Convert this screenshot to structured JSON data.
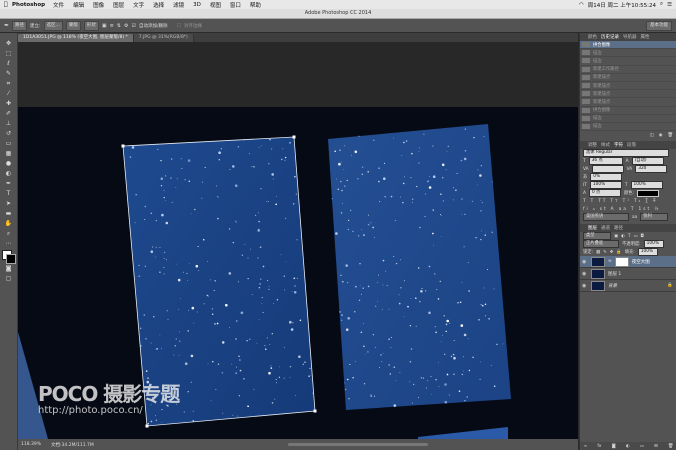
{
  "menubar": {
    "app": "Photoshop",
    "items": [
      "文件",
      "编辑",
      "图像",
      "图层",
      "文字",
      "选择",
      "滤镜",
      "3D",
      "视图",
      "窗口",
      "帮助"
    ],
    "clock": "周14日 周二 上午10:55:24"
  },
  "window_title": "Adobe Photoshop CC 2014",
  "options": {
    "mode": "路径",
    "make_label": "建立:",
    "selection_btn": "选区...",
    "mask_btn": "蒙版",
    "shape_btn": "形状",
    "auto_add_label": "自动添加/删除",
    "align_label": "对齐边缘",
    "workspace": "基本功能"
  },
  "tabs": [
    {
      "label": "1D1A3051.JPG @ 118% (夜空大图, 图层蒙版/8) *"
    },
    {
      "label": "7.JPG @ 31%(RGB/8*)"
    }
  ],
  "status": {
    "zoom": "118.39%",
    "doc": "文档:34.2M/111.7M"
  },
  "history": {
    "tabs": [
      "颜色",
      "历史记录",
      "导航器",
      "属性"
    ],
    "items": [
      "拼合图像",
      "描边",
      "描边",
      "新建工作路径",
      "新建锚点",
      "新建锚点",
      "新建锚点",
      "新建锚点",
      "拼合图像",
      "描边",
      "描边"
    ]
  },
  "character": {
    "tabs": [
      "调整",
      "样式",
      "字符",
      "段落"
    ],
    "font": "黑体 Regular",
    "size": "36 点",
    "leading": "(自动)",
    "tracking": "320",
    "kern": "0%",
    "scale_v": "100%",
    "scale_h": "100%",
    "baseline": "0 点",
    "color_label": "颜色:",
    "lang": "美国英语",
    "aa": "锐利"
  },
  "layers": {
    "kind": "类型",
    "blend": "正片叠底",
    "opacity_label": "不透明度:",
    "opacity": "100%",
    "lock_label": "锁定:",
    "fill_label": "填充:",
    "fill": "100%",
    "items": [
      {
        "name": "夜空大图"
      },
      {
        "name": "图层 1"
      },
      {
        "name": "背景"
      }
    ]
  },
  "watermark": {
    "brand": "POCO 摄影专题",
    "url": "http://photo.poco.cn/"
  }
}
